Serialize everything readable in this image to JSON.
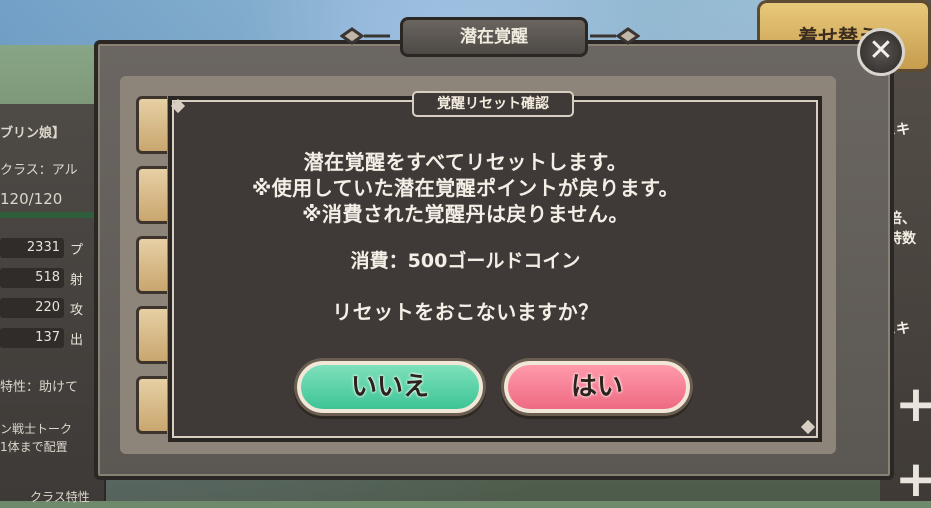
{
  "window": {
    "title": "潜在覚醒",
    "close_icon": "close-icon"
  },
  "dialog": {
    "title": "覚醒リセット確認",
    "lines": [
      "潜在覚醒をすべてリセットします。",
      "※使用していた潜在覚醒ポイントが戻ります。",
      "※消費された覚醒丹は戻りません。"
    ],
    "cost": "消費：500ゴールドコイン",
    "question": "リセットをおこないますか？",
    "no_label": "いいえ",
    "yes_label": "はい"
  },
  "left_panel": {
    "name": "ブリン娘】",
    "class": "クラス：アル",
    "hp": "120/120",
    "stats": [
      {
        "value": "2331",
        "tag": "プ"
      },
      {
        "value": "518",
        "tag": "射"
      },
      {
        "value": "220",
        "tag": "攻"
      },
      {
        "value": "137",
        "tag": "出"
      }
    ],
    "trait": "特性：助けて",
    "note1": "ン戦士トーク",
    "note2": "1体まで配置",
    "footer": "クラス特性"
  },
  "right_panel": {
    "top_label": "着せ替え",
    "skill1": "スキ",
    "line1": "倍、",
    "line2": "持数",
    "skill2": "スキ"
  },
  "colors": {
    "no_button": "#3ec496",
    "yes_button": "#ee6a83",
    "dialog_bg": "#3f3a37"
  }
}
